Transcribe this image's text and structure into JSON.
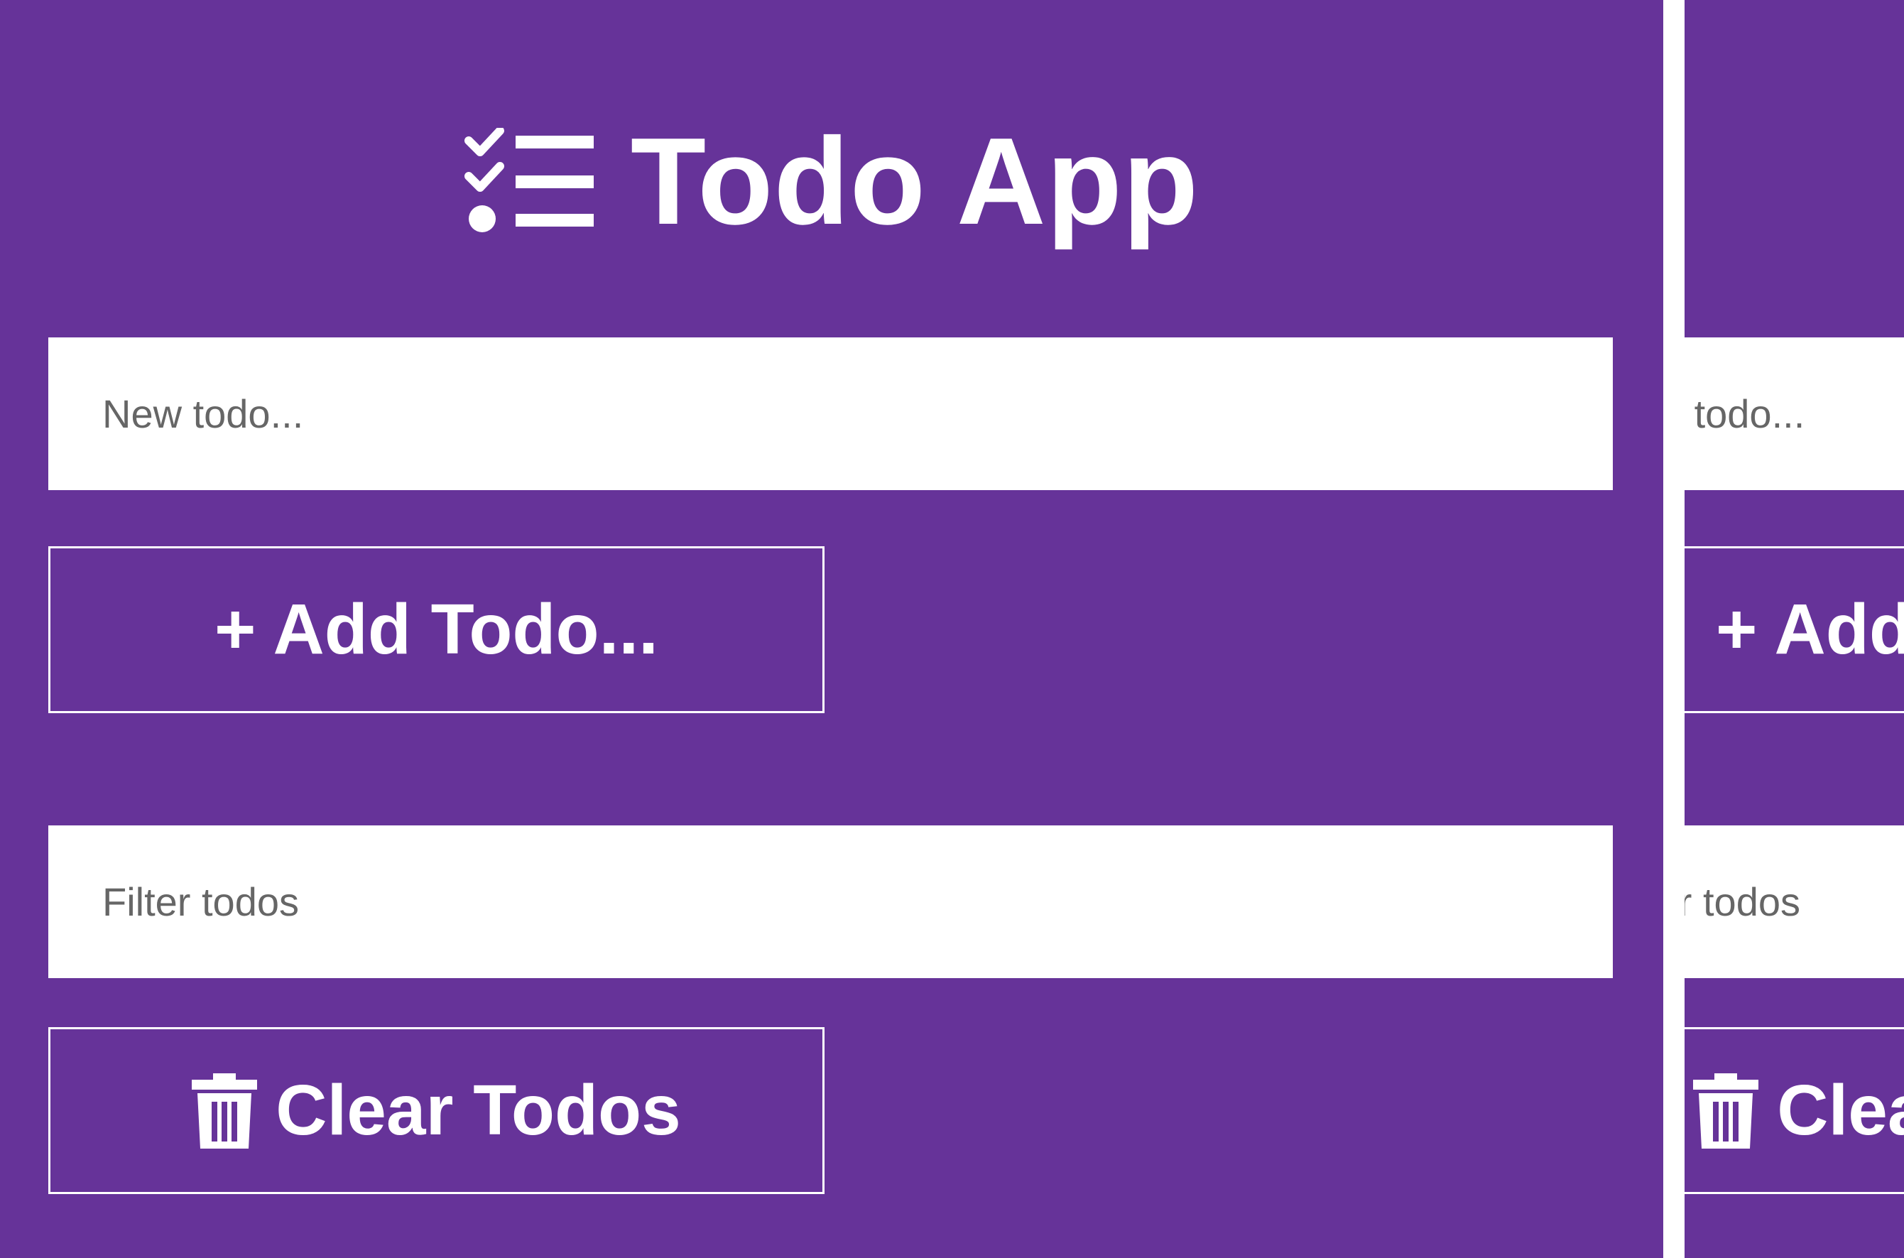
{
  "app": {
    "title": "Todo App",
    "title_icon": "checklist-icon",
    "colors": {
      "background": "#663399",
      "foreground": "#ffffff",
      "field_background": "#ffffff",
      "placeholder": "#666666"
    }
  },
  "new_todo": {
    "placeholder": "New todo...",
    "value": ""
  },
  "add_button": {
    "label": "+ Add Todo..."
  },
  "filter": {
    "placeholder": "Filter todos",
    "value": ""
  },
  "clear_button": {
    "label": "Clear Todos",
    "icon": "trash-icon"
  }
}
